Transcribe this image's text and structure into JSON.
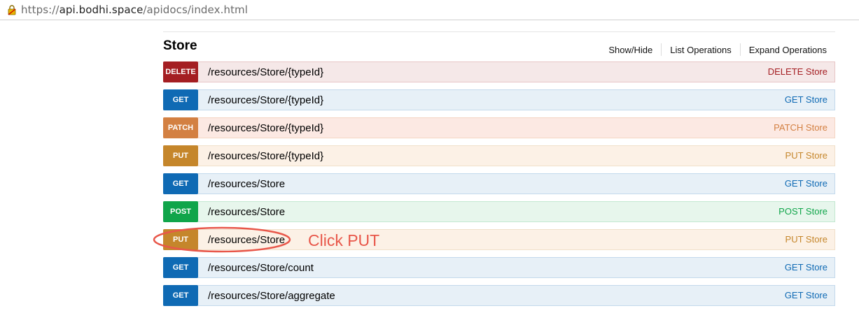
{
  "browser": {
    "url_scheme": "https://",
    "url_domain": "api.bodhi.space",
    "url_path": "/apidocs/index.html",
    "lock_icon": "lock-warning-icon"
  },
  "section": {
    "title": "Store",
    "links": {
      "show_hide": "Show/Hide",
      "list_operations": "List Operations",
      "expand_operations": "Expand Operations"
    }
  },
  "operations": [
    {
      "method": "DELETE",
      "path": "/resources/Store/{typeId}",
      "summary": "DELETE Store"
    },
    {
      "method": "GET",
      "path": "/resources/Store/{typeId}",
      "summary": "GET Store"
    },
    {
      "method": "PATCH",
      "path": "/resources/Store/{typeId}",
      "summary": "PATCH Store"
    },
    {
      "method": "PUT",
      "path": "/resources/Store/{typeId}",
      "summary": "PUT Store"
    },
    {
      "method": "GET",
      "path": "/resources/Store",
      "summary": "GET Store"
    },
    {
      "method": "POST",
      "path": "/resources/Store",
      "summary": "POST Store"
    },
    {
      "method": "PUT",
      "path": "/resources/Store",
      "summary": "PUT Store"
    },
    {
      "method": "GET",
      "path": "/resources/Store/count",
      "summary": "GET Store"
    },
    {
      "method": "GET",
      "path": "/resources/Store/aggregate",
      "summary": "GET Store"
    }
  ],
  "annotation": {
    "text": "Click PUT",
    "color": "#e8574a"
  },
  "colors": {
    "delete": "#a41e22",
    "get": "#0f6ab4",
    "patch": "#d38042",
    "put": "#c5862b",
    "post": "#10a54a"
  }
}
